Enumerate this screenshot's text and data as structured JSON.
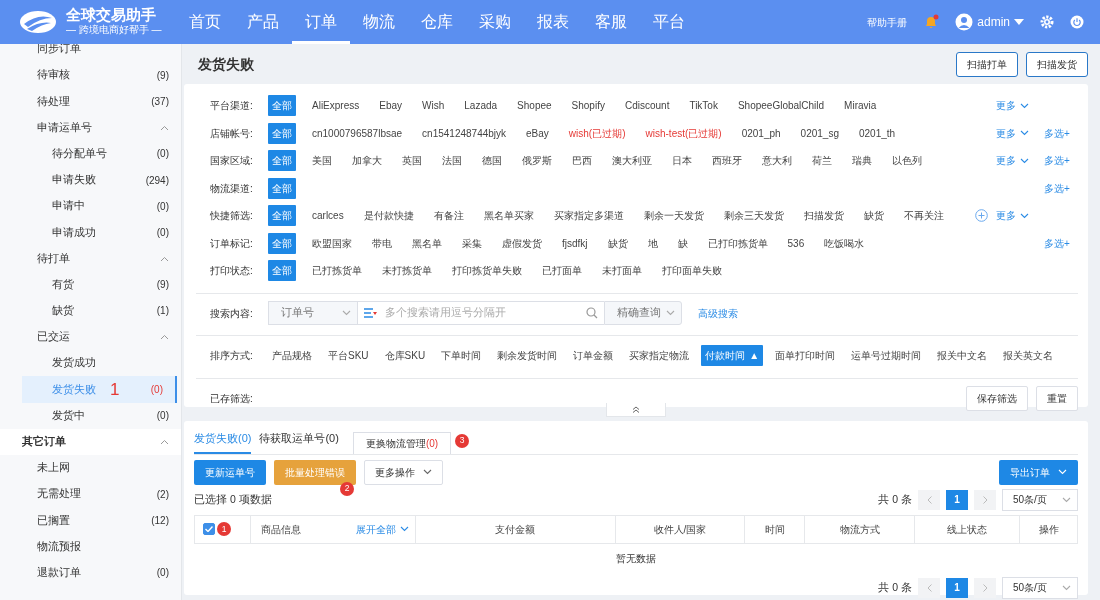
{
  "header": {
    "logo": {
      "title": "全球交易助手",
      "subtitle": "— 跨境电商好帮手 —"
    },
    "nav": [
      {
        "label": "首页",
        "selected": false
      },
      {
        "label": "产品",
        "selected": false
      },
      {
        "label": "订单",
        "selected": true
      },
      {
        "label": "物流",
        "selected": false
      },
      {
        "label": "仓库",
        "selected": false
      },
      {
        "label": "采购",
        "selected": false
      },
      {
        "label": "报表",
        "selected": false
      },
      {
        "label": "客服",
        "selected": false
      },
      {
        "label": "平台",
        "selected": false
      }
    ],
    "help": "帮助手册",
    "alert": true,
    "user": "admin"
  },
  "sidebar": {
    "items": [
      {
        "label": "同步订单",
        "selected": false
      },
      {
        "label": "待审核",
        "count": "(9)",
        "selected": false
      },
      {
        "label": "待处理",
        "count": "(37)",
        "selected": false
      },
      {
        "label": "申请运单号",
        "expanded": true,
        "selected": false,
        "children": [
          {
            "label": "待分配单号",
            "count": "(0)",
            "selected": false
          },
          {
            "label": "申请失败",
            "count": "(294)",
            "selected": false
          },
          {
            "label": "申请中",
            "count": "(0)",
            "selected": false
          },
          {
            "label": "申请成功",
            "count": "(0)",
            "selected": false
          }
        ]
      },
      {
        "label": "待打单",
        "expanded": true,
        "selected": false,
        "children": [
          {
            "label": "有货",
            "count": "(9)",
            "selected": false
          },
          {
            "label": "缺货",
            "count": "(1)",
            "selected": false
          }
        ]
      },
      {
        "label": "已交运",
        "expanded": true,
        "selected": false,
        "children": [
          {
            "label": "发货成功",
            "selected": false
          },
          {
            "label": "发货失败",
            "count": "(0)",
            "selected": true,
            "callout": "1"
          },
          {
            "label": "发货中",
            "count": "(0)",
            "selected": false
          }
        ]
      },
      {
        "label": "其它订单",
        "kind": "group",
        "expanded": true,
        "selected": false,
        "children": [
          {
            "label": "未上网",
            "selected": false
          },
          {
            "label": "无需处理",
            "count": "(2)",
            "selected": false
          },
          {
            "label": "已搁置",
            "count": "(12)",
            "selected": false
          },
          {
            "label": "物流预报",
            "selected": false
          },
          {
            "label": "退款订单",
            "count": "(0)",
            "selected": false
          }
        ]
      }
    ]
  },
  "page": {
    "title": "发货失败",
    "buttons": [
      "扫描打单",
      "扫描发货"
    ]
  },
  "filters": [
    {
      "label": "平台渠道:",
      "options": [
        {
          "label": "全部",
          "selected": true
        },
        {
          "label": "AliExpress",
          "selected": false
        },
        {
          "label": "Ebay",
          "selected": false
        },
        {
          "label": "Wish",
          "selected": false
        },
        {
          "label": "Lazada",
          "selected": false
        },
        {
          "label": "Shopee",
          "selected": false
        },
        {
          "label": "Shopify",
          "selected": false
        },
        {
          "label": "Cdiscount",
          "selected": false
        },
        {
          "label": "TikTok",
          "selected": false
        },
        {
          "label": "ShopeeGlobalChild",
          "selected": false
        },
        {
          "label": "Miravia",
          "selected": false
        }
      ],
      "more": "更多"
    },
    {
      "label": "店铺帐号:",
      "options": [
        {
          "label": "全部",
          "selected": true
        },
        {
          "label": "cn1000796587lbsae",
          "selected": false
        },
        {
          "label": "cn1541248744bjyk",
          "selected": false
        },
        {
          "label": "eBay",
          "selected": false
        },
        {
          "label": "wish(已过期)",
          "selected": false,
          "expired": true
        },
        {
          "label": "wish-test(已过期)",
          "selected": false,
          "expired": true
        },
        {
          "label": "0201_ph",
          "selected": false
        },
        {
          "label": "0201_sg",
          "selected": false
        },
        {
          "label": "0201_th",
          "selected": false
        }
      ],
      "more": "更多",
      "multi": "多选+"
    },
    {
      "label": "国家区域:",
      "options": [
        {
          "label": "全部",
          "selected": true
        },
        {
          "label": "美国",
          "selected": false
        },
        {
          "label": "加拿大",
          "selected": false
        },
        {
          "label": "英国",
          "selected": false
        },
        {
          "label": "法国",
          "selected": false
        },
        {
          "label": "德国",
          "selected": false
        },
        {
          "label": "俄罗斯",
          "selected": false
        },
        {
          "label": "巴西",
          "selected": false
        },
        {
          "label": "澳大利亚",
          "selected": false
        },
        {
          "label": "日本",
          "selected": false
        },
        {
          "label": "西班牙",
          "selected": false
        },
        {
          "label": "意大利",
          "selected": false
        },
        {
          "label": "荷兰",
          "selected": false
        },
        {
          "label": "瑞典",
          "selected": false
        },
        {
          "label": "以色列",
          "selected": false
        }
      ],
      "more": "更多",
      "multi": "多选+"
    },
    {
      "label": "物流渠道:",
      "options": [
        {
          "label": "全部",
          "selected": true
        }
      ],
      "multi": "多选+"
    },
    {
      "label": "快捷筛选:",
      "options": [
        {
          "label": "全部",
          "selected": true
        },
        {
          "label": "carlces",
          "selected": false
        },
        {
          "label": "是付款快捷",
          "selected": false
        },
        {
          "label": "有备注",
          "selected": false
        },
        {
          "label": "黑名单买家",
          "selected": false
        },
        {
          "label": "买家指定多渠道",
          "selected": false
        },
        {
          "label": "剩余一天发货",
          "selected": false
        },
        {
          "label": "剩余三天发货",
          "selected": false
        },
        {
          "label": "扫描发货",
          "selected": false
        },
        {
          "label": "缺货",
          "selected": false
        },
        {
          "label": "不再关注",
          "selected": false
        }
      ],
      "add": true,
      "more": "更多"
    },
    {
      "label": "订单标记:",
      "options": [
        {
          "label": "全部",
          "selected": true
        },
        {
          "label": "欧盟国家",
          "selected": false
        },
        {
          "label": "带电",
          "selected": false
        },
        {
          "label": "黑名单",
          "selected": false
        },
        {
          "label": "采集",
          "selected": false
        },
        {
          "label": "虚假发货",
          "selected": false
        },
        {
          "label": "fjsdfkj",
          "selected": false
        },
        {
          "label": "缺货",
          "selected": false
        },
        {
          "label": "地",
          "selected": false
        },
        {
          "label": "缺",
          "selected": false
        },
        {
          "label": "已打印拣货单",
          "selected": false
        },
        {
          "label": "536",
          "selected": false
        },
        {
          "label": "吃饭喝水",
          "selected": false
        }
      ],
      "multi": "多选+"
    },
    {
      "label": "打印状态:",
      "options": [
        {
          "label": "全部",
          "selected": true
        },
        {
          "label": "已打拣货单",
          "selected": false
        },
        {
          "label": "未打拣货单",
          "selected": false
        },
        {
          "label": "打印拣货单失败",
          "selected": false
        },
        {
          "label": "已打面单",
          "selected": false
        },
        {
          "label": "未打面单",
          "selected": false
        },
        {
          "label": "打印面单失败",
          "selected": false
        }
      ]
    }
  ],
  "search": {
    "label": "搜索内容:",
    "field": "订单号",
    "placeholder": "多个搜索请用逗号分隔开",
    "mode": "精确查询",
    "advanced": "高级搜索"
  },
  "sort": {
    "label": "排序方式:",
    "options": [
      {
        "label": "产品规格",
        "selected": false
      },
      {
        "label": "平台SKU",
        "selected": false
      },
      {
        "label": "仓库SKU",
        "selected": false
      },
      {
        "label": "下单时间",
        "selected": false
      },
      {
        "label": "剩余发货时间",
        "selected": false
      },
      {
        "label": "订单金额",
        "selected": false
      },
      {
        "label": "买家指定物流",
        "selected": false
      },
      {
        "label": "付款时间",
        "selected": true,
        "arrow": "▲"
      },
      {
        "label": "面单打印时间",
        "selected": false
      },
      {
        "label": "运单号过期时间",
        "selected": false
      },
      {
        "label": "报关中文名",
        "selected": false
      },
      {
        "label": "报关英文名",
        "selected": false
      }
    ]
  },
  "saved": {
    "label": "已存筛选:",
    "buttons": [
      "保存筛选",
      "重置"
    ]
  },
  "results": {
    "tabs": [
      {
        "label": "发货失败",
        "count": "(0)",
        "selected": true
      },
      {
        "label": "待获取运单号",
        "count": "(0)",
        "selected": false
      },
      {
        "label": "更换物流管理",
        "count": "(0)",
        "selected": false,
        "kind": "boxed",
        "callout": "3"
      }
    ],
    "actions": [
      {
        "label": "更新运单号",
        "kind": "primary"
      },
      {
        "label": "批量处理错误",
        "kind": "warning",
        "callout": "2"
      },
      {
        "label": "更多操作",
        "kind": "dropdown"
      }
    ],
    "export": "导出订单",
    "selection": "已选择 0 项数据",
    "pagination": {
      "total": "共 0 条",
      "page": "1",
      "size": "50条/页"
    },
    "table": {
      "select_all": {
        "checked": true,
        "callout": "1"
      },
      "columns": [
        {
          "label": "商品信息",
          "link": "展开全部"
        },
        {
          "label": "支付金额"
        },
        {
          "label": "收件人/国家"
        },
        {
          "label": "时间"
        },
        {
          "label": "物流方式"
        },
        {
          "label": "线上状态"
        },
        {
          "label": "操作"
        }
      ],
      "empty": "暂无数据"
    },
    "footer_pagination": {
      "total": "共 0 条",
      "page": "1",
      "size": "50条/页"
    }
  }
}
